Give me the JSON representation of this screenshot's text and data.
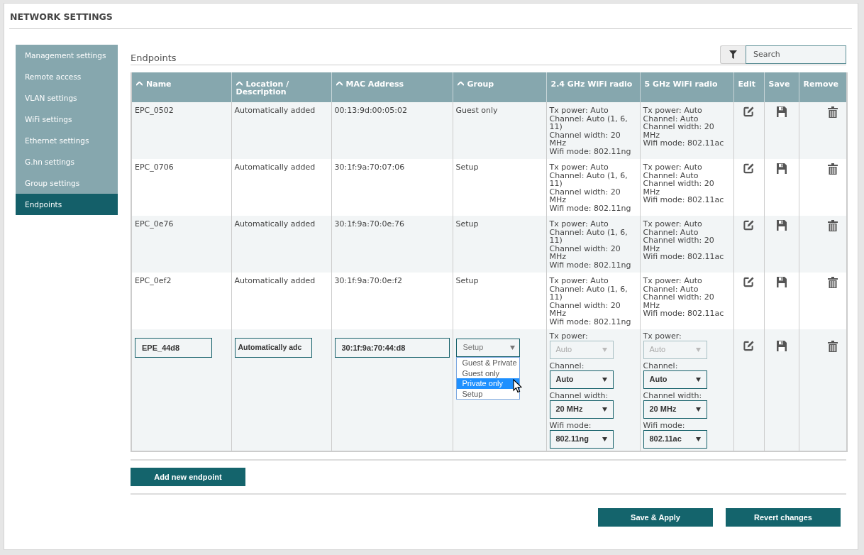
{
  "title": "NETWORK SETTINGS",
  "sidebar": {
    "items": [
      {
        "label": "Management settings",
        "selected": false
      },
      {
        "label": "Remote access",
        "selected": false
      },
      {
        "label": "VLAN settings",
        "selected": false
      },
      {
        "label": "WiFi settings",
        "selected": false
      },
      {
        "label": "Ethernet settings",
        "selected": false
      },
      {
        "label": "G.hn settings",
        "selected": false
      },
      {
        "label": "Group settings",
        "selected": false
      },
      {
        "label": "Endpoints",
        "selected": true
      }
    ]
  },
  "section_title": "Endpoints",
  "search": {
    "placeholder": "Search"
  },
  "table": {
    "columns": [
      {
        "label": "Name",
        "sortable": true
      },
      {
        "label": "Location / Description",
        "sortable": true
      },
      {
        "label": "MAC Address",
        "sortable": true
      },
      {
        "label": "Group",
        "sortable": true
      },
      {
        "label": "2.4 GHz WiFi radio",
        "sortable": false
      },
      {
        "label": "5 GHz WiFi radio",
        "sortable": false
      },
      {
        "label": "Edit",
        "sortable": false
      },
      {
        "label": "Save",
        "sortable": false
      },
      {
        "label": "Remove",
        "sortable": false
      }
    ],
    "rows": [
      {
        "name": "EPC_0502",
        "location": "Automatically added",
        "mac": "00:13:9d:00:05:02",
        "group": "Guest only",
        "radio_24": [
          "Tx power: Auto",
          "Channel: Auto (1, 6, 11)",
          "Channel width: 20 MHz",
          "Wifi mode: 802.11ng"
        ],
        "radio_5": [
          "Tx power: Auto",
          "Channel: Auto",
          "Channel width: 20 MHz",
          "Wifi mode: 802.11ac"
        ]
      },
      {
        "name": "EPC_0706",
        "location": "Automatically added",
        "mac": "30:1f:9a:70:07:06",
        "group": "Setup",
        "radio_24": [
          "Tx power: Auto",
          "Channel: Auto (1, 6, 11)",
          "Channel width: 20 MHz",
          "Wifi mode: 802.11ng"
        ],
        "radio_5": [
          "Tx power: Auto",
          "Channel: Auto",
          "Channel width: 20 MHz",
          "Wifi mode: 802.11ac"
        ]
      },
      {
        "name": "EPC_0e76",
        "location": "Automatically added",
        "mac": "30:1f:9a:70:0e:76",
        "group": "Setup",
        "radio_24": [
          "Tx power: Auto",
          "Channel: Auto (1, 6, 11)",
          "Channel width: 20 MHz",
          "Wifi mode: 802.11ng"
        ],
        "radio_5": [
          "Tx power: Auto",
          "Channel: Auto",
          "Channel width: 20 MHz",
          "Wifi mode: 802.11ac"
        ]
      },
      {
        "name": "EPC_0ef2",
        "location": "Automatically added",
        "mac": "30:1f:9a:70:0e:f2",
        "group": "Setup",
        "radio_24": [
          "Tx power: Auto",
          "Channel: Auto (1, 6, 11)",
          "Channel width: 20 MHz",
          "Wifi mode: 802.11ng"
        ],
        "radio_5": [
          "Tx power: Auto",
          "Channel: Auto",
          "Channel width: 20 MHz",
          "Wifi mode: 802.11ac"
        ]
      }
    ],
    "edit_row": {
      "name": "EPE_44d8",
      "location": "Automatically adc",
      "mac": "30:1f:9a:70:44:d8",
      "group": {
        "value": "Setup",
        "options": [
          {
            "label": "Guest & Private",
            "highlighted": false
          },
          {
            "label": "Guest only",
            "highlighted": false
          },
          {
            "label": "Private only",
            "highlighted": true
          },
          {
            "label": "Setup",
            "highlighted": false
          }
        ]
      },
      "radio_24": [
        {
          "label": "Tx power:",
          "value": "Auto",
          "disabled": true
        },
        {
          "label": "Channel:",
          "value": "Auto",
          "disabled": false
        },
        {
          "label": "Channel width:",
          "value": "20 MHz",
          "disabled": false
        },
        {
          "label": "Wifi mode:",
          "value": "802.11ng",
          "disabled": false
        }
      ],
      "radio_5": [
        {
          "label": "Tx power:",
          "value": "Auto",
          "disabled": true
        },
        {
          "label": "Channel:",
          "value": "Auto",
          "disabled": false
        },
        {
          "label": "Channel width:",
          "value": "20 MHz",
          "disabled": false
        },
        {
          "label": "Wifi mode:",
          "value": "802.11ac",
          "disabled": false
        }
      ]
    }
  },
  "add_button": "Add new endpoint",
  "footer_buttons": [
    "Save & Apply",
    "Revert changes"
  ]
}
